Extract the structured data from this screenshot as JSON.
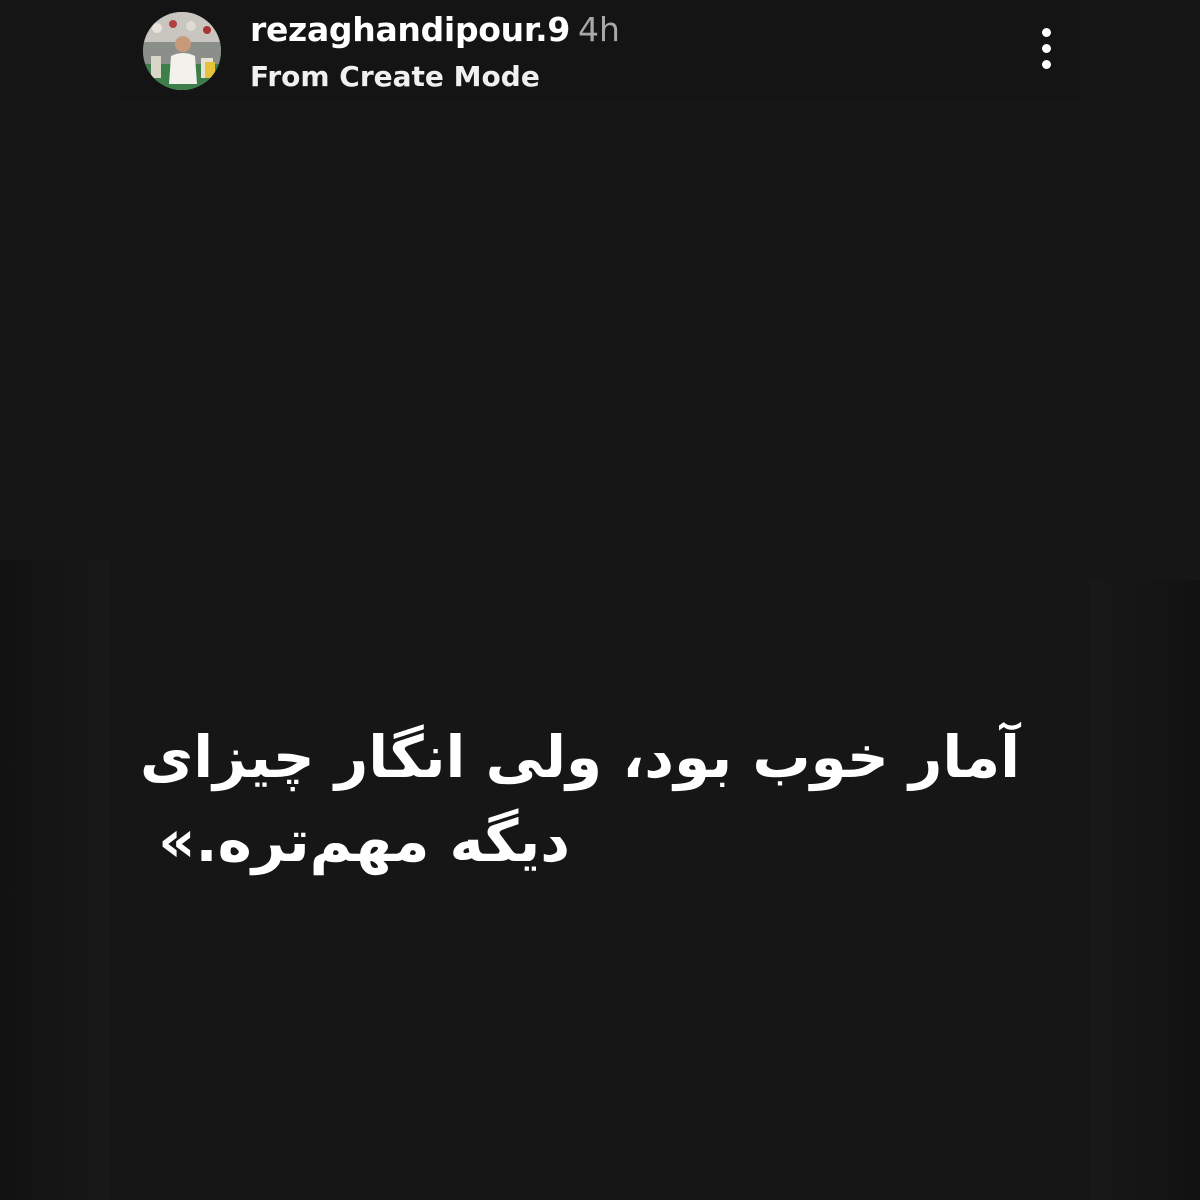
{
  "story": {
    "username": "rezaghandipour.9",
    "time_ago": "4h",
    "subtitle": "From Create Mode",
    "more_icon": "more-vertical-icon",
    "caption_lines": [
      "آمار خوب بود، ولی انگار چیزای",
      "دیگه مهم‌تره.»"
    ]
  },
  "colors": {
    "background": "#161616",
    "text": "#ffffff",
    "time": "#a8a8a8"
  }
}
